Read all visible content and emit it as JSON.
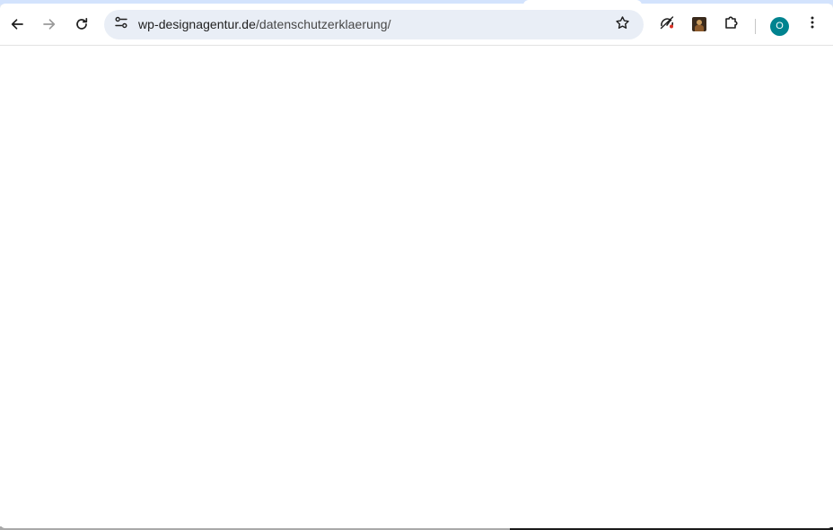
{
  "browser": {
    "address_bar": {
      "domain": "wp-designagentur.de",
      "path": "/datenschutzerklaerung/"
    },
    "icons": {
      "back": "arrow-left-icon",
      "forward": "arrow-right-icon",
      "reload": "reload-icon",
      "site_info": "tune-icon",
      "bookmark": "star-outline-icon",
      "performance": "speedometer-off-icon",
      "extension": "extension-thumbnail-icon",
      "extensions_menu": "puzzle-piece-icon",
      "more": "vertical-dots-icon"
    },
    "profile": {
      "initial": "O",
      "color": "#00838f"
    }
  },
  "colors": {
    "frame": "#d3e3fd",
    "omnibox_bg": "#e9eef6",
    "page_bg": "#ffffff"
  }
}
